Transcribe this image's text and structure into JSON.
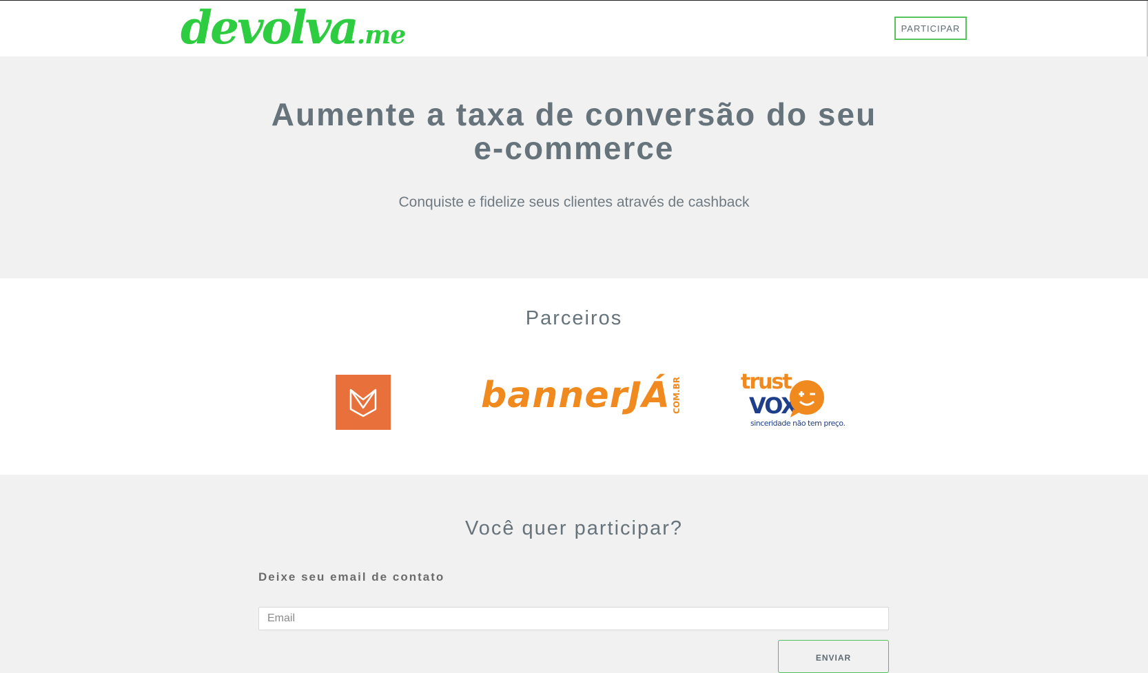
{
  "header": {
    "logo_main": "devolva",
    "logo_suffix": ".me",
    "participar_label": "PARTICIPAR"
  },
  "hero": {
    "title_line1": "Aumente a taxa de conversão do seu",
    "title_line2": "e-commerce",
    "subtitle": "Conquiste e fidelize seus clientes através de cashback"
  },
  "partners": {
    "title": "Parceiros",
    "logo_b_main": "bannerJÁ",
    "logo_b_suffix": "COM.BR",
    "logo_c_top": "trust",
    "logo_c_bottom": "VOX",
    "logo_c_tagline": "sinceridade não tem preço."
  },
  "contact": {
    "title": "Você quer participar?",
    "email_label": "Deixe seu email de contato",
    "email_placeholder": "Email",
    "email_value": "",
    "submit_label": "ENVIAR"
  },
  "colors": {
    "brand_green": "#2ecc40",
    "text_gray": "#66737b",
    "partner_orange": "#f08a1f",
    "partner_blue": "#1f3f8a",
    "partner_a_bg": "#e8703a"
  },
  "icons": [
    "fox-shield-logo",
    "smiley-bubble-icon"
  ]
}
